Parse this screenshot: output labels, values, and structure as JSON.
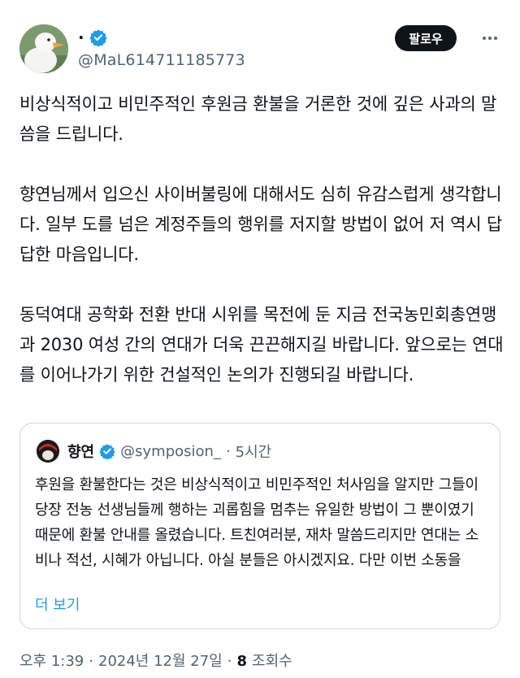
{
  "author": {
    "display_name": "·",
    "handle": "@MaL614711185773",
    "avatar": "duck-avatar",
    "verified": true
  },
  "header": {
    "follow_label": "팔로우",
    "more_icon": "more-icon"
  },
  "tweet": {
    "paragraphs": [
      "비상식적이고 비민주적인 후원금 환불을 거론한 것에 깊은 사과의 말씀을 드립니다.",
      "향연님께서 입으신 사이버불링에 대해서도 심히 유감스럽게 생각합니다. 일부 도를 넘은 계정주들의 행위를 저지할 방법이 없어 저 역시 답답한 마음입니다.",
      "동덕여대 공학화 전환 반대 시위를 목전에 둔 지금 전국농민회총연맹과 2030 여성 간의 연대가 더욱 끈끈해지길 바랍니다. 앞으로는 연대를 이어나가기 위한 건설적인 논의가 진행되길 바랍니다."
    ]
  },
  "quote": {
    "name": "향연",
    "handle": "@symposion_",
    "separator": "·",
    "time": "5시간",
    "text": "후원을 환불한다는 것은 비상식적이고 비민주적인 처사임을 알지만 그들이 당장 전농 선생님들께 행하는 괴롭힘을 멈추는 유일한 방법이 그 뿐이였기 때문에 환불 안내를 올렸습니다. 트친여러분, 재차 말씀드리지만 연대는 소비나 적선, 시혜가 아닙니다. 아실 분들은 아시겠지요. 다만 이번 소동을",
    "more_label": "더 보기",
    "verified": true
  },
  "meta": {
    "time": "오후 1:39",
    "sep1": "·",
    "date": "2024년 12월 27일",
    "sep2": "·",
    "views_count": "8",
    "views_label": "조회수"
  },
  "colors": {
    "verified_blue": "#1d9bf0",
    "text": "#0f1419",
    "muted": "#536471",
    "border": "#cfd9de"
  }
}
